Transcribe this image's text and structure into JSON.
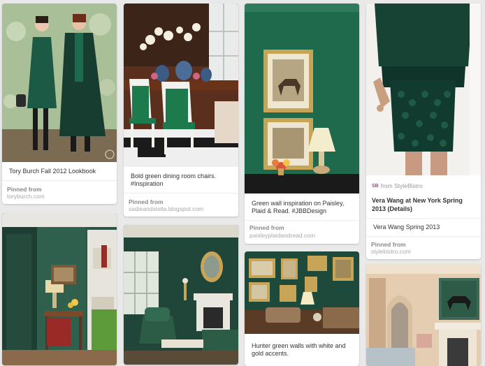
{
  "pins": [
    {
      "id": "pin1",
      "description": "Tory Burch Fall 2012 Lookbook",
      "pinned_from_label": "Pinned from",
      "source": "toryburch.com"
    },
    {
      "id": "pin2",
      "description": "Bold green dining room chairs. #Inspiration",
      "pinned_from_label": "Pinned from",
      "source": "sadieandstella.blogspot.com"
    },
    {
      "id": "pin3",
      "description": "Green wall inspiration on Paisley, Plaid & Read. #JBBDesign",
      "pinned_from_label": "Pinned from",
      "source": "paisleyplaidandread.com"
    },
    {
      "id": "pin4",
      "from_prefix": "from StyleBistro",
      "from_icon": "SB",
      "title": "Vera Wang at New York Spring 2013 (Details)",
      "description": "Vera Wang Spring 2013",
      "pinned_from_label": "Pinned from",
      "source": "stylebistro.com"
    },
    {
      "id": "pin5"
    },
    {
      "id": "pin6"
    },
    {
      "id": "pin7",
      "description": "Hunter green walls with white and gold accents."
    },
    {
      "id": "pin8"
    }
  ],
  "colors": {
    "page_bg": "#e9e9e9",
    "card_bg": "#ffffff",
    "hunter_green": "#1f4a36",
    "source_text": "#a8a8a8"
  }
}
